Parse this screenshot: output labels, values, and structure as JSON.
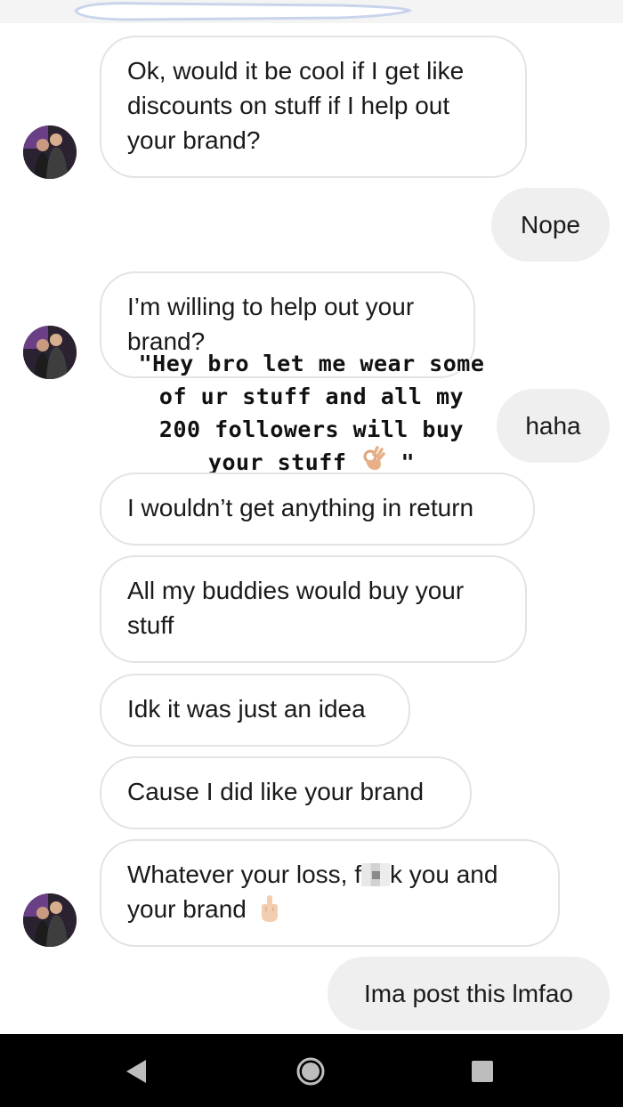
{
  "messages": {
    "m1": "Ok, would it be cool if I get like discounts on stuff if I help out your brand?",
    "m2": "Nope",
    "m3": "I’m willing to help out your brand?",
    "m4": "haha",
    "m5": "I wouldn’t get anything in return",
    "m6": "All my buddies would buy your stuff",
    "m7": "Idk it was just an idea",
    "m8": "Cause I did like your brand",
    "m9_before": "Whatever your loss, f",
    "m9_after": "k you and your brand",
    "m10": "Ima post this lmfao"
  },
  "caption": {
    "line1": "\"Hey bro let me wear some",
    "line2": "of ur stuff and all my",
    "line3": "200 followers will buy",
    "line4": "your stuff",
    "close_quote": "\""
  },
  "icons": {
    "ok_hand": "ok-hand-emoji",
    "middle_finger": "middle-finger-emoji",
    "nav_back": "back-triangle",
    "nav_home": "home-circle",
    "nav_recent": "recent-square"
  },
  "colors": {
    "incoming_border": "#e3e3e3",
    "outgoing_bg": "#efefef",
    "navbar": "#000000"
  }
}
